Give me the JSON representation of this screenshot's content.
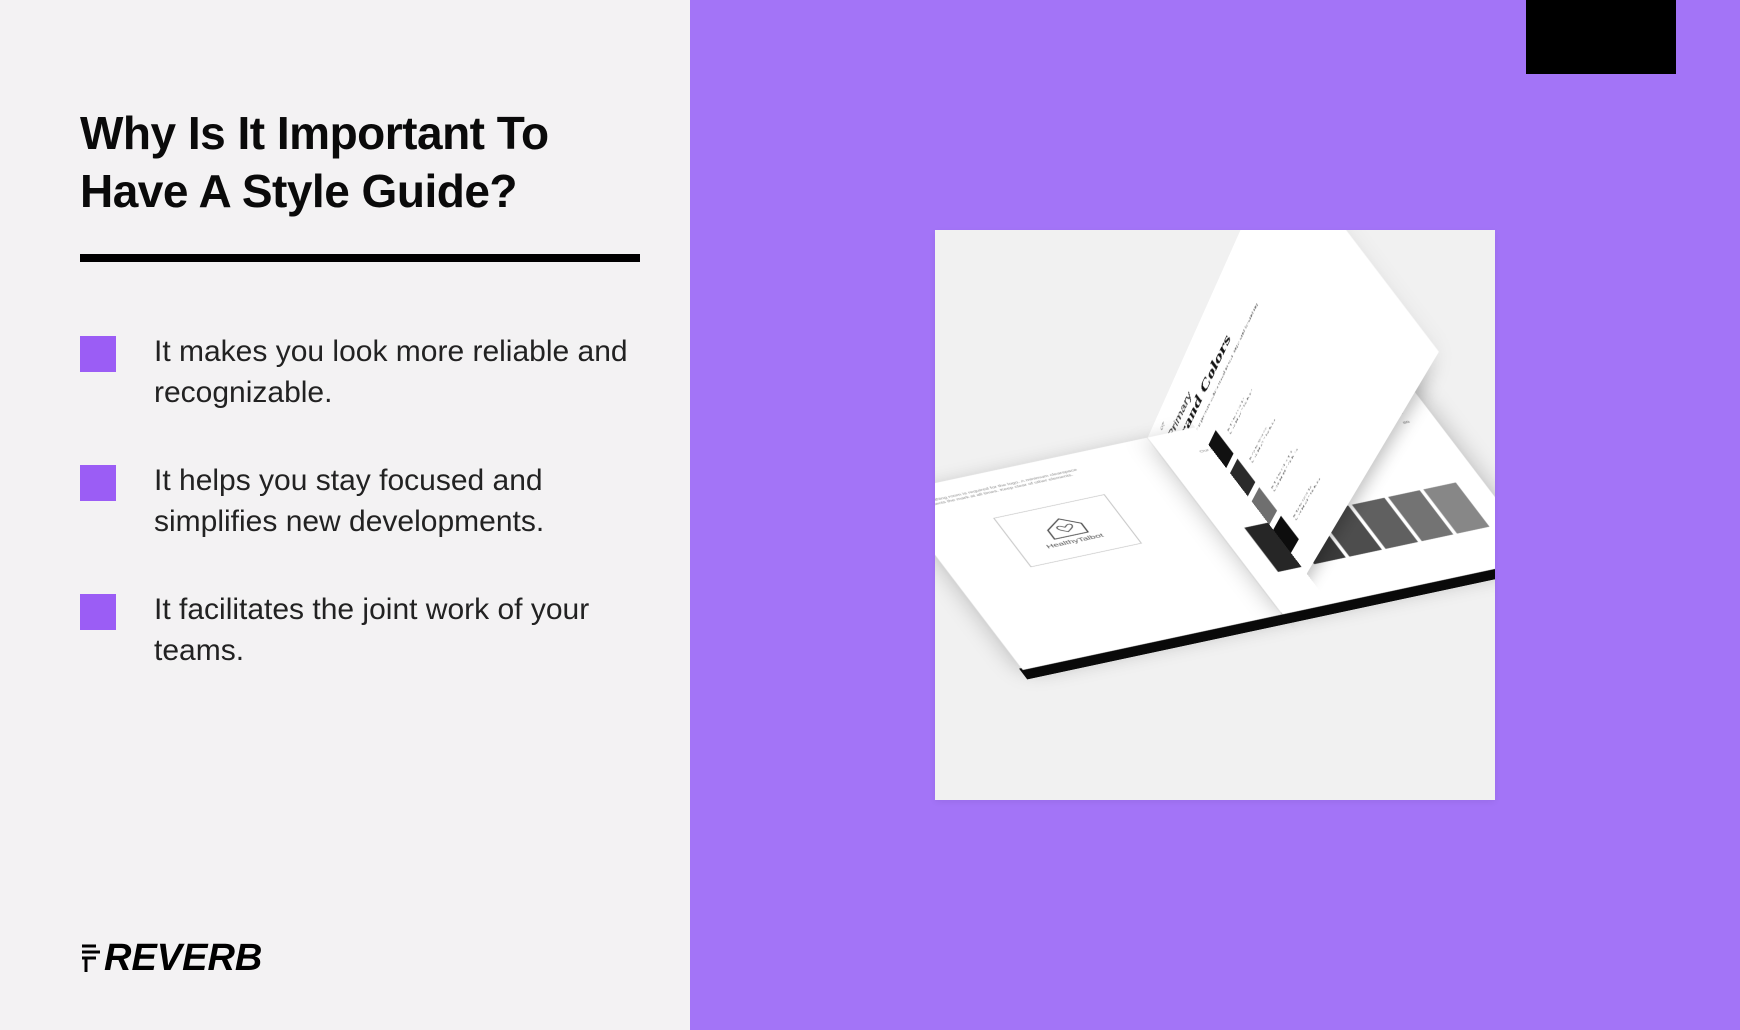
{
  "heading": "Why Is It Important To Have A Style Guide?",
  "bullets": [
    "It makes you look more reliable and recognizable.",
    "It helps you stay focused and simplifies new developments.",
    "It facilitates the joint work of your teams."
  ],
  "logo_text": "REVERB",
  "colors": {
    "accent_purple": "#a374f7",
    "bullet_square": "#9b5df5",
    "left_bg": "#f3f2f3",
    "black": "#000000"
  },
  "mockup": {
    "page_number": "07",
    "flip_title_small": "Primary",
    "flip_title": "Brand Colors",
    "flip_subtitle": "These are the primary colors used in our logo and branding materials.",
    "brand_name": "HealthyTalbot",
    "right_page_heading": "Colors",
    "right_page_values": [
      "20",
      "40",
      "60",
      "80",
      "20",
      "40",
      "60",
      "80",
      "20",
      "40",
      "60",
      "80"
    ],
    "primary_swatches": [
      {
        "hex": "#111111"
      },
      {
        "hex": "#2a2a2a"
      },
      {
        "hex": "#6f6f6f"
      },
      {
        "hex": "#0d0d0d"
      }
    ],
    "gradient_swatches": [
      "#262626",
      "#3a3a3a",
      "#4d4d4d",
      "#606060",
      "#737373",
      "#878787"
    ]
  }
}
